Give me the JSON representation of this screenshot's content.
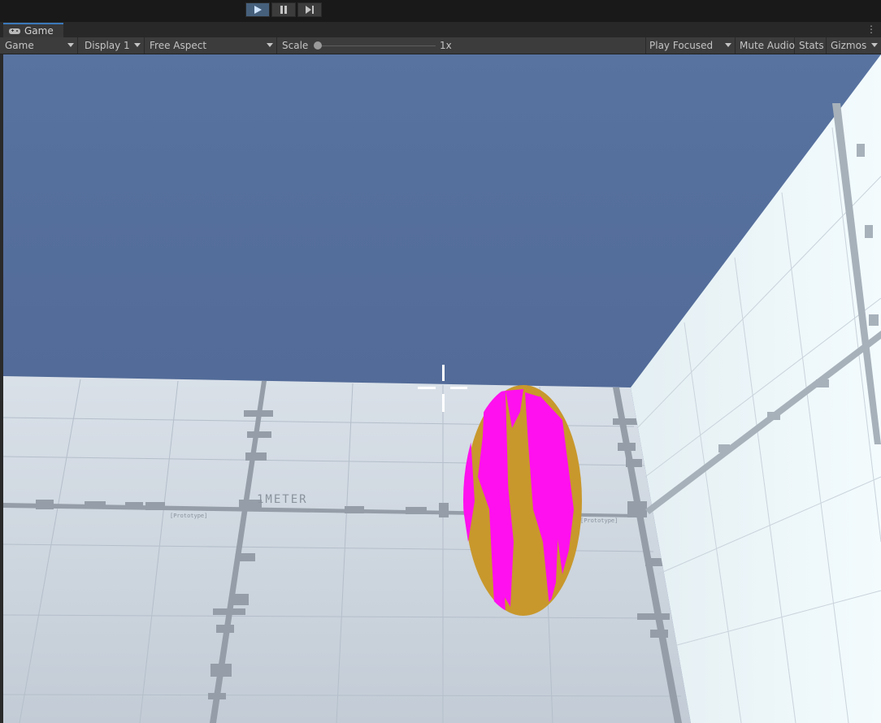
{
  "playbar": {
    "play_icon": "play-icon",
    "pause_icon": "pause-icon",
    "step_icon": "step-icon",
    "play_active": true
  },
  "tab": {
    "label": "Game",
    "icon": "gamepad-icon"
  },
  "toolbar": {
    "view_select": "Game",
    "display_select": "Display 1",
    "aspect_select": "Free Aspect",
    "scale_label": "Scale",
    "scale_value": "1x",
    "play_mode": "Play Focused",
    "mute_audio": "Mute Audio",
    "stats": "Stats",
    "gizmos": "Gizmos"
  },
  "scene": {
    "floor_labels": {
      "meter": "1METER",
      "prototype": "[Prototype]"
    },
    "colors": {
      "sky_top": "#5873a0",
      "sky_bottom": "#4e6590",
      "floor": "#c9d2dc",
      "wall": "#e9f3f7",
      "grid_marks": "#9098a0",
      "egg_base": "#c8982c",
      "egg_stripes": "#ff10ee",
      "crosshair": "#ffffff"
    }
  }
}
